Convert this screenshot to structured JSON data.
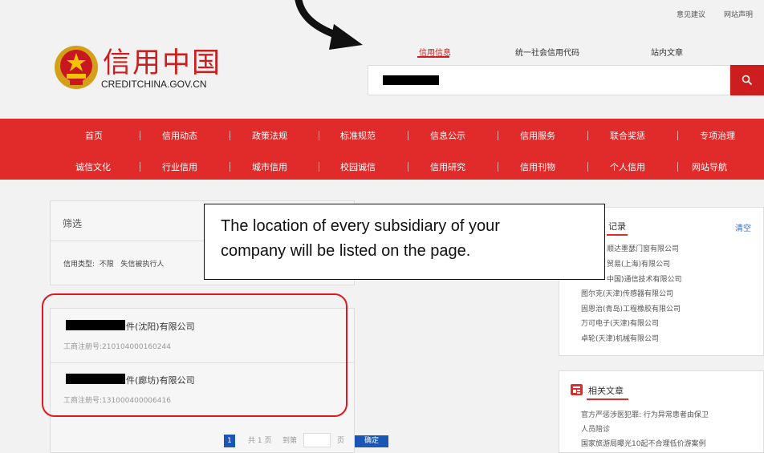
{
  "top_links": [
    "意见建议",
    "网站声明"
  ],
  "logo": {
    "title": "信用中国",
    "subtitle": "CREDITCHINA.GOV.CN"
  },
  "search": {
    "tabs": [
      "信用信息",
      "统一社会信用代码",
      "站内文章"
    ],
    "active_tab": 0
  },
  "nav": {
    "row1": [
      "首页",
      "信用动态",
      "政策法规",
      "标准规范",
      "信息公示",
      "信用服务",
      "联合奖惩",
      "专项治理"
    ],
    "row2": [
      "诚信文化",
      "行业信用",
      "城市信用",
      "校园诚信",
      "信用研究",
      "信用刊物",
      "个人信用",
      "网站导航"
    ]
  },
  "filter": {
    "title": "筛选",
    "type_label": "信用类型:",
    "options": [
      "不限",
      "失信被执行人"
    ]
  },
  "results": [
    {
      "name_suffix": "件(沈阳)有限公司",
      "reg_label": "工商注册号:",
      "reg_no": "210104000160244"
    },
    {
      "name_suffix": "件(廊坊)有限公司",
      "reg_label": "工商注册号:",
      "reg_no": "131000400006416"
    }
  ],
  "pagination": {
    "current": "1",
    "total_text": "共 1 页",
    "goto_text": "到第",
    "page_unit": "页",
    "confirm_label": "确定"
  },
  "history": {
    "title_tail": "记录",
    "clear_label": "清空",
    "items": [
      "顺达墨瑟门窗有限公司",
      "贸易(上海)有限公司",
      "中国)通信技术有限公司",
      "图尔克(天津)传感器有限公司",
      "固恩治(青岛)工程橡胶有限公司",
      "万可电子(天津)有限公司",
      "卓轮(天津)机械有限公司"
    ]
  },
  "related": {
    "title": "相关文章",
    "items": [
      "官方严惩涉医犯罪: 行为异常患者由保卫",
      "人员陪诊",
      "国家旅游局曝光10起不合理低价游案例"
    ]
  },
  "callout": {
    "line1": "The location of every subsidiary of your",
    "line2": "company will be listed on the page."
  },
  "colors": {
    "brand_red": "#e12b2b",
    "link_blue": "#3b6cc0",
    "pager_blue": "#1a56b3"
  }
}
